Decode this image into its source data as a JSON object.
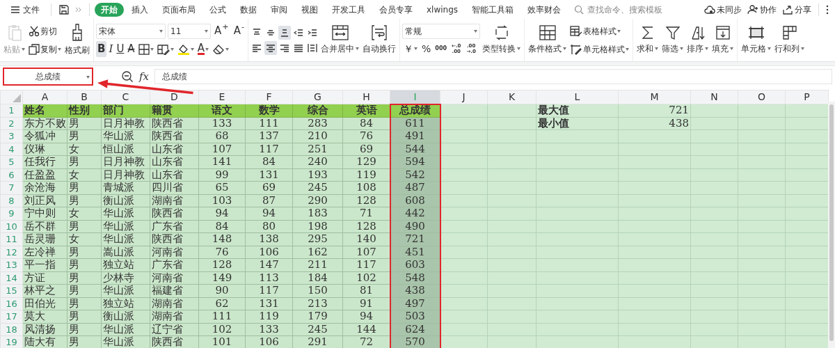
{
  "menu": {
    "file": "文件",
    "tabs": [
      {
        "label": "开始",
        "selected": true
      },
      {
        "label": "插入",
        "selected": false
      },
      {
        "label": "页面布局",
        "selected": false
      },
      {
        "label": "公式",
        "selected": false
      },
      {
        "label": "数据",
        "selected": false
      },
      {
        "label": "审阅",
        "selected": false
      },
      {
        "label": "视图",
        "selected": false
      },
      {
        "label": "开发工具",
        "selected": false
      },
      {
        "label": "会员专享",
        "selected": false
      },
      {
        "label": "xlwings",
        "selected": false
      },
      {
        "label": "智能工具箱",
        "selected": false
      },
      {
        "label": "效率财会",
        "selected": false
      }
    ],
    "search": {
      "placeholder": "查找命令、搜索模板"
    },
    "actions": [
      {
        "kind": "cloud",
        "label": "未同步"
      },
      {
        "kind": "person",
        "label": "协作"
      },
      {
        "kind": "share",
        "label": "分享"
      }
    ]
  },
  "ribbon": {
    "clipboard": [
      {
        "kind": "paste",
        "label": "粘贴",
        "disabled": true
      },
      {
        "kind": "cut",
        "label": "剪切",
        "disabled": false
      },
      {
        "kind": "copy",
        "label": "复制",
        "disabled": false
      },
      {
        "kind": "brush",
        "label": "格式刷",
        "disabled": false
      }
    ],
    "font": {
      "name": "宋体",
      "size": "11",
      "grow": "A$^{+}$",
      "shrink": "A$^{-}$"
    },
    "font_buttons": [
      {
        "kind": "bold",
        "label": "B",
        "selected": true
      },
      {
        "kind": "italic",
        "label": "I",
        "selected": false
      },
      {
        "kind": "underline",
        "label": "U",
        "selected": false
      },
      {
        "kind": "strike",
        "label": "A",
        "selected": false
      },
      {
        "kind": "border",
        "selected": false
      },
      {
        "kind": "cellstyle",
        "selected": false
      },
      {
        "kind": "fill",
        "selected": false
      },
      {
        "kind": "fontcolor",
        "label": "A",
        "selected": false
      },
      {
        "kind": "eraser",
        "selected": false
      }
    ],
    "align_buttons": [
      {
        "kind": "top",
        "selected": false
      },
      {
        "kind": "middle",
        "selected": false
      },
      {
        "kind": "bottom",
        "selected": true
      },
      {
        "kind": "outdent",
        "selected": false
      },
      {
        "kind": "indent",
        "selected": false
      },
      {
        "kind": "left",
        "selected": false
      },
      {
        "kind": "center",
        "selected": true
      },
      {
        "kind": "right",
        "selected": false
      },
      {
        "kind": "justify",
        "selected": false
      },
      {
        "kind": "distribute",
        "selected": false
      }
    ],
    "merge": "合并居中",
    "wrap": "自动换行",
    "number_format": "常规",
    "number_buttons": [
      {
        "label": "￥"
      },
      {
        "label": "%"
      },
      {
        "label": "000"
      },
      {
        "top": "←.0",
        "bottom": ".00"
      },
      {
        "top": ".00",
        "bottom": "→.0"
      }
    ],
    "convert": "类型转换",
    "conditional": "条件格式",
    "table_style": "表格样式",
    "cell_style": "单元格样式",
    "tools": [
      {
        "kind": "sum",
        "label": "求和"
      },
      {
        "kind": "filter",
        "label": "筛选"
      },
      {
        "kind": "sort",
        "label": "排序"
      },
      {
        "kind": "fill",
        "label": "填充"
      },
      {
        "kind": "cell",
        "label": "单元格"
      },
      {
        "kind": "rowcol",
        "label": "行和列"
      }
    ]
  },
  "formula_bar": {
    "name_box": "总成绩",
    "fx": "fx",
    "value": "总成绩"
  },
  "sheet": {
    "columns": [
      {
        "label": "A",
        "selected": false
      },
      {
        "label": "B",
        "selected": false
      },
      {
        "label": "C",
        "selected": false
      },
      {
        "label": "D",
        "selected": false
      },
      {
        "label": "E",
        "selected": false
      },
      {
        "label": "F",
        "selected": false
      },
      {
        "label": "G",
        "selected": false
      },
      {
        "label": "H",
        "selected": false
      },
      {
        "label": "I",
        "selected": true
      },
      {
        "label": "J",
        "selected": false
      },
      {
        "label": "K",
        "selected": false
      },
      {
        "label": "L",
        "selected": false
      },
      {
        "label": "M",
        "selected": false
      },
      {
        "label": "N",
        "selected": false
      },
      {
        "label": "O",
        "selected": false
      },
      {
        "label": "P",
        "selected": false
      }
    ],
    "header": {
      "number": "1",
      "cells": [
        "姓名",
        "性别",
        "部门",
        "籍贯",
        "语文",
        "数学",
        "综合",
        "英语",
        "总成绩"
      ]
    },
    "rows": [
      {
        "number": "2",
        "cells": [
          "东方不败",
          "男",
          "日月神教",
          "陕西省",
          "133",
          "111",
          "283",
          "84",
          "611"
        ]
      },
      {
        "number": "3",
        "cells": [
          "令狐冲",
          "男",
          "华山派",
          "陕西省",
          "68",
          "137",
          "210",
          "76",
          "491"
        ]
      },
      {
        "number": "4",
        "cells": [
          "仪琳",
          "女",
          "恒山派",
          "山东省",
          "107",
          "117",
          "251",
          "69",
          "544"
        ]
      },
      {
        "number": "5",
        "cells": [
          "任我行",
          "男",
          "日月神教",
          "山东省",
          "141",
          "84",
          "240",
          "129",
          "594"
        ]
      },
      {
        "number": "6",
        "cells": [
          "任盈盈",
          "女",
          "日月神教",
          "山东省",
          "99",
          "131",
          "193",
          "119",
          "542"
        ]
      },
      {
        "number": "7",
        "cells": [
          "余沧海",
          "男",
          "青城派",
          "四川省",
          "65",
          "69",
          "245",
          "108",
          "487"
        ]
      },
      {
        "number": "8",
        "cells": [
          "刘正风",
          "男",
          "衡山派",
          "湖南省",
          "103",
          "87",
          "290",
          "128",
          "608"
        ]
      },
      {
        "number": "9",
        "cells": [
          "宁中则",
          "女",
          "华山派",
          "陕西省",
          "94",
          "94",
          "183",
          "71",
          "442"
        ]
      },
      {
        "number": "10",
        "cells": [
          "岳不群",
          "男",
          "华山派",
          "广东省",
          "84",
          "80",
          "198",
          "128",
          "490"
        ]
      },
      {
        "number": "11",
        "cells": [
          "岳灵珊",
          "女",
          "华山派",
          "陕西省",
          "148",
          "138",
          "295",
          "140",
          "721"
        ]
      },
      {
        "number": "12",
        "cells": [
          "左冷禅",
          "男",
          "嵩山派",
          "河南省",
          "76",
          "106",
          "162",
          "107",
          "451"
        ]
      },
      {
        "number": "13",
        "cells": [
          "平一指",
          "男",
          "独立站",
          "广东省",
          "128",
          "147",
          "211",
          "117",
          "603"
        ]
      },
      {
        "number": "14",
        "cells": [
          "方证",
          "男",
          "少林寺",
          "河南省",
          "149",
          "113",
          "184",
          "102",
          "548"
        ]
      },
      {
        "number": "15",
        "cells": [
          "林平之",
          "男",
          "华山派",
          "福建省",
          "90",
          "117",
          "150",
          "81",
          "438"
        ]
      },
      {
        "number": "16",
        "cells": [
          "田伯光",
          "男",
          "独立站",
          "湖南省",
          "62",
          "131",
          "213",
          "91",
          "497"
        ]
      },
      {
        "number": "17",
        "cells": [
          "莫大",
          "男",
          "衡山派",
          "湖南省",
          "111",
          "119",
          "179",
          "94",
          "503"
        ]
      },
      {
        "number": "18",
        "cells": [
          "风清扬",
          "男",
          "华山派",
          "辽宁省",
          "102",
          "133",
          "245",
          "144",
          "624"
        ]
      },
      {
        "number": "19",
        "cells": [
          "陆大有",
          "男",
          "华山派",
          "陕西省",
          "101",
          "106",
          "291",
          "72",
          "570"
        ]
      }
    ],
    "stats": [
      {
        "label": "最大值",
        "value": "721"
      },
      {
        "label": "最小值",
        "value": "438"
      }
    ]
  }
}
